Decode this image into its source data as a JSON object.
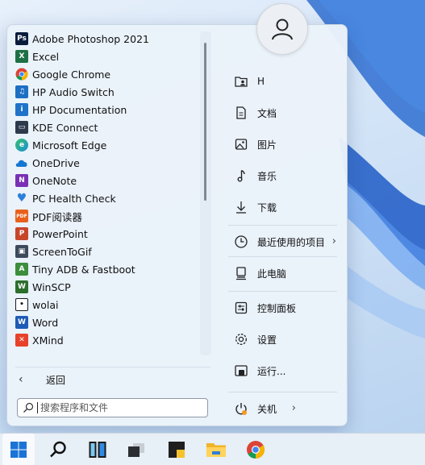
{
  "apps": [
    {
      "label": "Adobe Photoshop 2021",
      "icon": "photoshop-icon",
      "glyph": "Ps",
      "color": "#0a1d3d"
    },
    {
      "label": "Excel",
      "icon": "excel-icon",
      "glyph": "X",
      "color": "#1d7044"
    },
    {
      "label": "Google Chrome",
      "icon": "chrome-icon",
      "glyph": "",
      "color": "#4285f4"
    },
    {
      "label": "HP Audio Switch",
      "icon": "hp-audio-switch-icon",
      "glyph": "♫",
      "color": "#1d6fc4"
    },
    {
      "label": "HP Documentation",
      "icon": "hp-documentation-icon",
      "glyph": "i",
      "color": "#1f73c9"
    },
    {
      "label": "KDE Connect",
      "icon": "kde-connect-icon",
      "glyph": "▭",
      "color": "#2d3a4c"
    },
    {
      "label": "Microsoft Edge",
      "icon": "edge-icon",
      "glyph": "e",
      "color": "#1b8fd6"
    },
    {
      "label": "OneDrive",
      "icon": "onedrive-icon",
      "glyph": "☁",
      "color": "#1677d2"
    },
    {
      "label": "OneNote",
      "icon": "onenote-icon",
      "glyph": "N",
      "color": "#7b2fb5"
    },
    {
      "label": "PC Health Check",
      "icon": "pc-health-check-icon",
      "glyph": "♥",
      "color": "#2d7fd8"
    },
    {
      "label": "PDF阅读器",
      "icon": "pdf-reader-icon",
      "glyph": "PDF",
      "color": "#e8601c"
    },
    {
      "label": "PowerPoint",
      "icon": "powerpoint-icon",
      "glyph": "P",
      "color": "#c7462b"
    },
    {
      "label": "ScreenToGif",
      "icon": "screentogif-icon",
      "glyph": "▣",
      "color": "#3d4a5c"
    },
    {
      "label": "Tiny ADB & Fastboot",
      "icon": "tiny-adb-icon",
      "glyph": "A",
      "color": "#3c8d3c"
    },
    {
      "label": "WinSCP",
      "icon": "winscp-icon",
      "glyph": "W",
      "color": "#2c6e2c"
    },
    {
      "label": "wolai",
      "icon": "wolai-icon",
      "glyph": "•",
      "color": "#1a1a1a"
    },
    {
      "label": "Word",
      "icon": "word-icon",
      "glyph": "W",
      "color": "#1f5bb6"
    },
    {
      "label": "XMind",
      "icon": "xmind-icon",
      "glyph": "✕",
      "color": "#e8412b"
    }
  ],
  "back": {
    "label": "返回"
  },
  "search": {
    "placeholder": "搜索程序和文件"
  },
  "places": [
    {
      "label": "H",
      "icon": "user-folder-icon",
      "name": "place-item-user"
    },
    {
      "label": "文档",
      "icon": "documents-icon",
      "name": "place-item-documents"
    },
    {
      "label": "图片",
      "icon": "pictures-icon",
      "name": "place-item-pictures"
    },
    {
      "label": "音乐",
      "icon": "music-icon",
      "name": "place-item-music"
    },
    {
      "label": "下载",
      "icon": "downloads-icon",
      "name": "place-item-downloads"
    },
    {
      "label": "最近使用的项目",
      "icon": "recent-icon",
      "name": "place-item-recent"
    },
    {
      "label": "此电脑",
      "icon": "this-pc-icon",
      "name": "place-item-this-pc"
    },
    {
      "label": "控制面板",
      "icon": "control-panel-icon",
      "name": "place-item-control-panel"
    },
    {
      "label": "设置",
      "icon": "settings-icon",
      "name": "place-item-settings"
    },
    {
      "label": "运行...",
      "icon": "run-icon",
      "name": "place-item-run"
    },
    {
      "label": "关机",
      "icon": "power-icon",
      "name": "place-item-shutdown"
    }
  ],
  "taskbar": [
    {
      "icon": "windows-start-icon"
    },
    {
      "icon": "search-icon"
    },
    {
      "icon": "task-view-icon"
    },
    {
      "icon": "window-switcher-icon"
    },
    {
      "icon": "sticky-notes-icon"
    },
    {
      "icon": "file-explorer-icon"
    },
    {
      "icon": "chrome-icon"
    }
  ],
  "colors": {
    "accent": "#0067c0",
    "menu_bg": "#ebf2fa",
    "taskbar_bg": "#e8eff7"
  }
}
